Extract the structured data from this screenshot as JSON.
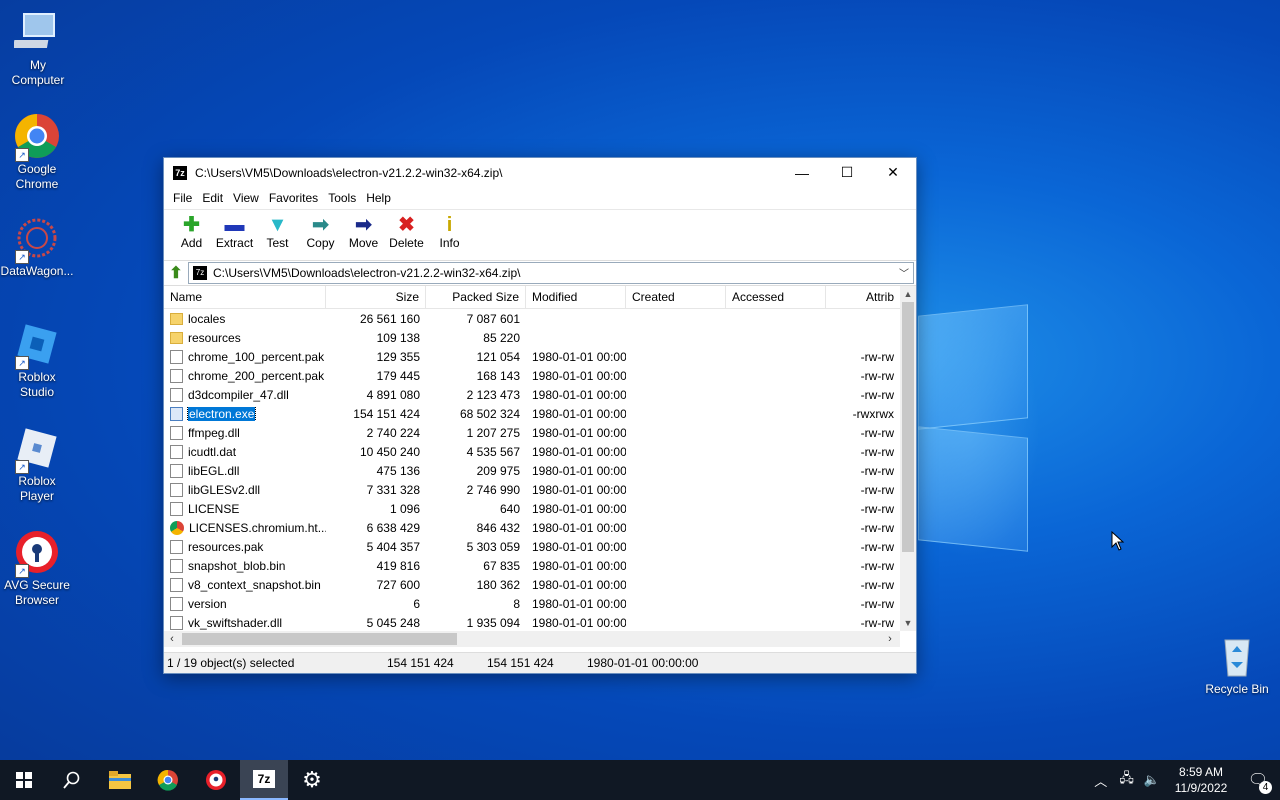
{
  "desktop": {
    "icons": [
      {
        "label": "My\nComputer",
        "line1": "My",
        "line2": "Computer"
      },
      {
        "line1": "Google",
        "line2": "Chrome"
      },
      {
        "line1": "DataWagon...",
        "line2": ""
      },
      {
        "line1": "Roblox",
        "line2": "Studio"
      },
      {
        "line1": "Roblox",
        "line2": "Player"
      },
      {
        "line1": "AVG Secure",
        "line2": "Browser"
      },
      {
        "line1": "Recycle Bin",
        "line2": ""
      }
    ]
  },
  "window": {
    "app_icon": "7z",
    "title": "C:\\Users\\VM5\\Downloads\\electron-v21.2.2-win32-x64.zip\\",
    "controls": {
      "minimize": "—",
      "maximize": "☐",
      "close": "✕"
    },
    "menu": [
      "File",
      "Edit",
      "View",
      "Favorites",
      "Tools",
      "Help"
    ],
    "toolbar": [
      {
        "label": "Add",
        "icon": "add-icon",
        "glyph": "✚",
        "color": "#2aa52a"
      },
      {
        "label": "Extract",
        "icon": "extract-icon",
        "glyph": "▬",
        "color": "#2038b8"
      },
      {
        "label": "Test",
        "icon": "test-icon",
        "glyph": "▼",
        "color": "#28b8c8"
      },
      {
        "label": "Copy",
        "icon": "copy-icon",
        "glyph": "➡",
        "color": "#2a8a8a"
      },
      {
        "label": "Move",
        "icon": "move-icon",
        "glyph": "➡",
        "color": "#1a2a8a"
      },
      {
        "label": "Delete",
        "icon": "delete-icon",
        "glyph": "✖",
        "color": "#d82020"
      },
      {
        "label": "Info",
        "icon": "info-icon",
        "glyph": "i",
        "color": "#c8a800"
      }
    ],
    "address": "C:\\Users\\VM5\\Downloads\\electron-v21.2.2-win32-x64.zip\\",
    "columns": [
      "Name",
      "Size",
      "Packed Size",
      "Modified",
      "Created",
      "Accessed",
      "Attrib"
    ],
    "files": [
      {
        "name": "locales",
        "type": "folder",
        "size": "26 561 160",
        "packed": "7 087 601",
        "modified": "",
        "attrib": ""
      },
      {
        "name": "resources",
        "type": "folder",
        "size": "109 138",
        "packed": "85 220",
        "modified": "",
        "attrib": ""
      },
      {
        "name": "chrome_100_percent.pak",
        "type": "file",
        "size": "129 355",
        "packed": "121 054",
        "modified": "1980-01-01 00:00",
        "attrib": "-rw-rw"
      },
      {
        "name": "chrome_200_percent.pak",
        "type": "file",
        "size": "179 445",
        "packed": "168 143",
        "modified": "1980-01-01 00:00",
        "attrib": "-rw-rw"
      },
      {
        "name": "d3dcompiler_47.dll",
        "type": "dll",
        "size": "4 891 080",
        "packed": "2 123 473",
        "modified": "1980-01-01 00:00",
        "attrib": "-rw-rw"
      },
      {
        "name": "electron.exe",
        "type": "exe",
        "size": "154 151 424",
        "packed": "68 502 324",
        "modified": "1980-01-01 00:00",
        "attrib": "-rwxrwx",
        "selected": true
      },
      {
        "name": "ffmpeg.dll",
        "type": "dll",
        "size": "2 740 224",
        "packed": "1 207 275",
        "modified": "1980-01-01 00:00",
        "attrib": "-rw-rw"
      },
      {
        "name": "icudtl.dat",
        "type": "file",
        "size": "10 450 240",
        "packed": "4 535 567",
        "modified": "1980-01-01 00:00",
        "attrib": "-rw-rw"
      },
      {
        "name": "libEGL.dll",
        "type": "dll",
        "size": "475 136",
        "packed": "209 975",
        "modified": "1980-01-01 00:00",
        "attrib": "-rw-rw"
      },
      {
        "name": "libGLESv2.dll",
        "type": "dll",
        "size": "7 331 328",
        "packed": "2 746 990",
        "modified": "1980-01-01 00:00",
        "attrib": "-rw-rw"
      },
      {
        "name": "LICENSE",
        "type": "file",
        "size": "1 096",
        "packed": "640",
        "modified": "1980-01-01 00:00",
        "attrib": "-rw-rw"
      },
      {
        "name": "LICENSES.chromium.ht...",
        "type": "chrome",
        "size": "6 638 429",
        "packed": "846 432",
        "modified": "1980-01-01 00:00",
        "attrib": "-rw-rw"
      },
      {
        "name": "resources.pak",
        "type": "file",
        "size": "5 404 357",
        "packed": "5 303 059",
        "modified": "1980-01-01 00:00",
        "attrib": "-rw-rw"
      },
      {
        "name": "snapshot_blob.bin",
        "type": "file",
        "size": "419 816",
        "packed": "67 835",
        "modified": "1980-01-01 00:00",
        "attrib": "-rw-rw"
      },
      {
        "name": "v8_context_snapshot.bin",
        "type": "file",
        "size": "727 600",
        "packed": "180 362",
        "modified": "1980-01-01 00:00",
        "attrib": "-rw-rw"
      },
      {
        "name": "version",
        "type": "file",
        "size": "6",
        "packed": "8",
        "modified": "1980-01-01 00:00",
        "attrib": "-rw-rw"
      },
      {
        "name": "vk_swiftshader.dll",
        "type": "dll",
        "size": "5 045 248",
        "packed": "1 935 094",
        "modified": "1980-01-01 00:00",
        "attrib": "-rw-rw"
      }
    ],
    "status": {
      "selection": "1 / 19 object(s) selected",
      "size": "154 151 424",
      "packed": "154 151 424",
      "modified": "1980-01-01 00:00:00"
    }
  },
  "taskbar": {
    "time": "8:59 AM",
    "date": "11/9/2022",
    "notifications": "4"
  }
}
